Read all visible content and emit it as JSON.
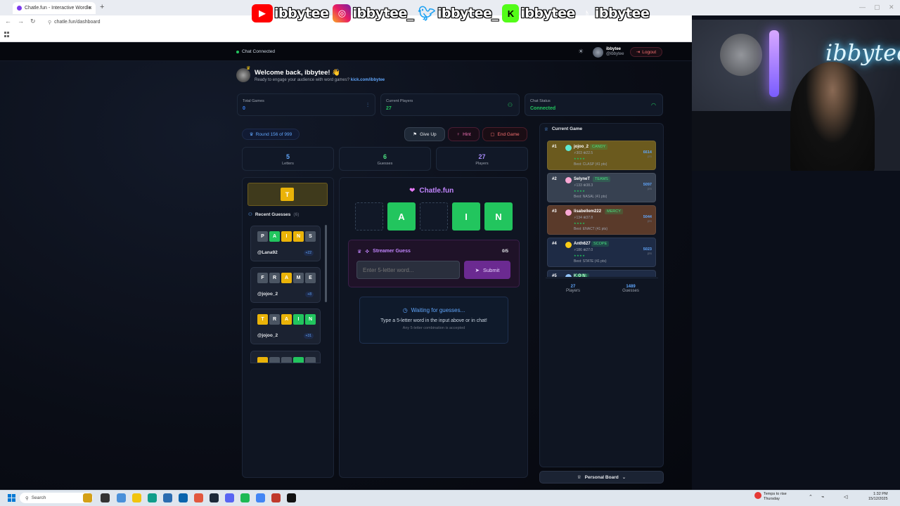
{
  "browser": {
    "tab_title": "Chatle.fun - Interactive Wordle",
    "url": "chatle.fun/dashboard"
  },
  "overlay": {
    "handles": [
      "ibbytee",
      "ibbytee_",
      "ibbytee_",
      "ibbytee",
      "ibbytee"
    ],
    "neon_sign": "ibbytee"
  },
  "header": {
    "status": "Chat Connected",
    "user_name": "ibbytee",
    "user_handle": "@ibbytee",
    "logout_label": "Logout"
  },
  "welcome": {
    "title": "Welcome back, ibbytee! 👋",
    "subtitle": "Ready to engage your audience with word games?",
    "link": "kick.com/ibbytee"
  },
  "stats": [
    {
      "label": "Total Games",
      "value": "0",
      "color": "#3b82f6"
    },
    {
      "label": "Current Players",
      "value": "27",
      "color": "#22c55e"
    },
    {
      "label": "Chat Status",
      "value": "Connected",
      "color": "#22c55e"
    }
  ],
  "game": {
    "round": "Round 156 of 999",
    "give_up": "Give Up",
    "hint": "Hint",
    "end_game": "End Game",
    "letters": "5",
    "letters_label": "Letters",
    "guesses": "6",
    "guesses_label": "Guesses",
    "players": "27",
    "players_label": "Players",
    "hint_letter": "T",
    "recent_title": "Recent Guesses",
    "recent_count": "(6)",
    "brand": "Chatle.fun",
    "board": [
      "",
      "A",
      "",
      "I",
      "N"
    ],
    "streamer_title": "Streamer Guess",
    "streamer_count": "0/5",
    "input_placeholder": "Enter 5-letter word...",
    "submit": "Submit",
    "waiting_title": "Waiting for guesses...",
    "waiting_text": "Type a 5-letter word in the input above or in chat!",
    "waiting_note": "Any 5-letter combination is accepted"
  },
  "recent_guesses": [
    {
      "letters": [
        "P",
        "A",
        "I",
        "N",
        "S"
      ],
      "states": [
        "gray",
        "grn",
        "yel",
        "yel",
        "gray"
      ],
      "user": "@Lana92",
      "points": "+22"
    },
    {
      "letters": [
        "F",
        "R",
        "A",
        "M",
        "E"
      ],
      "states": [
        "gray",
        "gray",
        "yel",
        "gray",
        "gray"
      ],
      "user": "@jojoo_2",
      "points": "+8"
    },
    {
      "letters": [
        "T",
        "R",
        "A",
        "I",
        "N"
      ],
      "states": [
        "yel",
        "gray",
        "yel",
        "grn",
        "grn"
      ],
      "user": "@jojoo_2",
      "points": "+31"
    }
  ],
  "leaderboard": {
    "title": "Current Game",
    "entries": [
      {
        "rank": "#1",
        "name": "jojoo_2",
        "word": "CANDY",
        "stats": "⚡303 ⊗22.5",
        "best": "Best: CLASP (41 pts)",
        "score": "6614",
        "unit": "pts",
        "color": "#6b5a1e"
      },
      {
        "rank": "#2",
        "name": "SelyneT",
        "word": "TEAMS",
        "stats": "⚡133 ⊗38.3",
        "best": "Best: NASAL (41 pts)",
        "score": "5097",
        "unit": "pts",
        "color": "#374151"
      },
      {
        "rank": "#3",
        "name": "lisabellem222",
        "word": "MERCY",
        "stats": "⚡134 ⊗37.8",
        "best": "Best: ENACT (41 pts)",
        "score": "5044",
        "unit": "pts",
        "color": "#5a3a2a"
      },
      {
        "rank": "#4",
        "name": "Anth627",
        "word": "SCOPE",
        "stats": "⚡186 ⊗27.0",
        "best": "Best: STATE (41 pts)",
        "score": "5023",
        "unit": "pts",
        "color": "#1e2b45"
      },
      {
        "rank": "#5",
        "name": "K O N",
        "word": "GAINS",
        "stats": "",
        "best": "",
        "score": "",
        "unit": "",
        "color": "#1e2b45"
      }
    ],
    "players": "27",
    "players_label": "Players",
    "guesses": "1489",
    "guesses_label": "Guesses",
    "personal_board": "Personal Board"
  },
  "taskbar": {
    "search": "Search",
    "weather_title": "Temps to rise",
    "weather_day": "Thursday",
    "time": "1:32 PM",
    "date": "15/12/2025"
  }
}
